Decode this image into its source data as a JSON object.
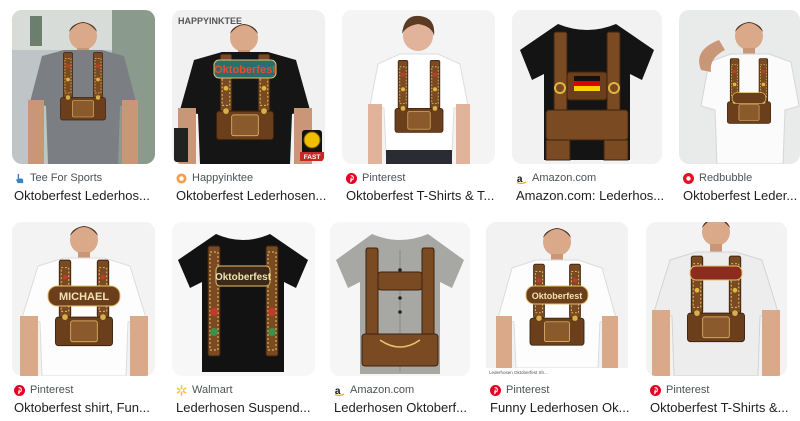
{
  "results": [
    {
      "source": "Tee For Sports",
      "source_icon": "hand-pointer-icon",
      "title": "Oktoberfest Lederhos..."
    },
    {
      "source": "Happyinktee",
      "source_icon": "happyinktee-logo-icon",
      "title": "Oktoberfest Lederhosen...",
      "watermark": "HAPPYINKTEE",
      "shirt_text": "Oktoberfest",
      "badge": "FAST"
    },
    {
      "source": "Pinterest",
      "source_icon": "pinterest-icon",
      "title": "Oktoberfest T-Shirts & T..."
    },
    {
      "source": "Amazon.com",
      "source_icon": "amazon-icon",
      "title": "Amazon.com: Lederhos..."
    },
    {
      "source": "Redbubble",
      "source_icon": "redbubble-icon",
      "title": "Oktoberfest Leder..."
    },
    {
      "source": "Pinterest",
      "source_icon": "pinterest-icon",
      "title": "Oktoberfest shirt, Fun...",
      "shirt_text": "MICHAEL"
    },
    {
      "source": "Walmart",
      "source_icon": "walmart-spark-icon",
      "title": "Lederhosen Suspend...",
      "shirt_text": "Oktoberfest"
    },
    {
      "source": "Amazon.com",
      "source_icon": "amazon-icon",
      "title": "Lederhosen Oktoberf..."
    },
    {
      "source": "Pinterest",
      "source_icon": "pinterest-icon",
      "title": "Funny Lederhosen Ok...",
      "shirt_text": "Oktoberfest",
      "caption": "Lederhosen Oktoberfest Sh..."
    },
    {
      "source": "Pinterest",
      "source_icon": "pinterest-icon",
      "title": "Oktoberfest T-Shirts &..."
    }
  ],
  "colors": {
    "pinterest": "#e60023",
    "amazon": "#ff9900",
    "redbubble": "#e41321",
    "walmart": "#ffc220",
    "leather": "#7a4a22",
    "leather_dark": "#4a2a12"
  }
}
